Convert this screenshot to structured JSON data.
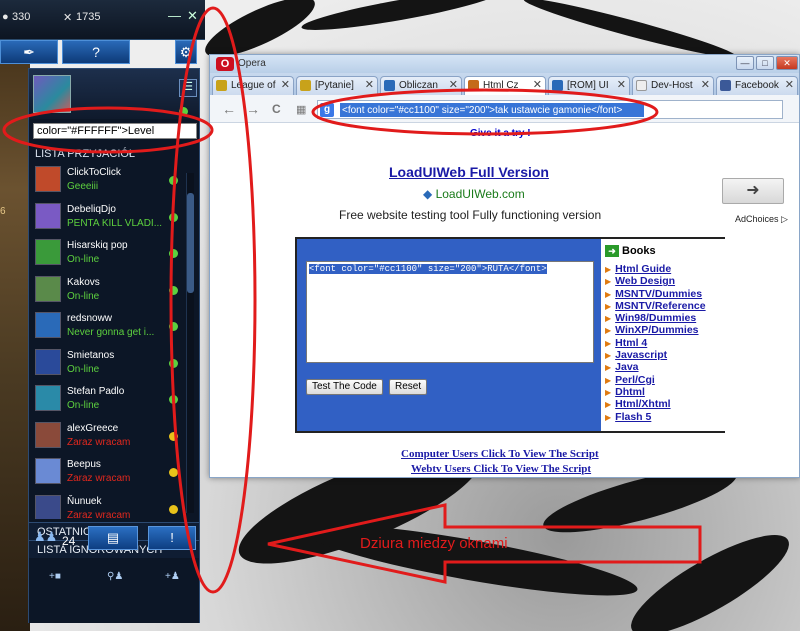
{
  "lol_client": {
    "currency_ip": "330",
    "currency_rp": "1735",
    "help_symbol": "?",
    "side_number": "6",
    "status_input_value": "color=\"#FFFFFF\">Level",
    "friends_header": "LISTA PRZYJACIÓŁ",
    "friends": [
      {
        "name": "ClickToClick",
        "status": "Geeeiii",
        "status_color": "#5dd13f",
        "dot_color": "#5cd13f",
        "avatar_color": "#c04a2a"
      },
      {
        "name": "DebeliqDjo",
        "status": "PENTA KILL VLADI...",
        "status_color": "#5dd13f",
        "dot_color": "#5cd13f",
        "avatar_color": "#7a5ac4"
      },
      {
        "name": "Hisarskiq pop",
        "status": "On-line",
        "status_color": "#5dd13f",
        "dot_color": "#5cd13f",
        "avatar_color": "#3a9a3a"
      },
      {
        "name": "Kakovs",
        "status": "On-line",
        "status_color": "#5dd13f",
        "dot_color": "#5cd13f",
        "avatar_color": "#5a8a4a"
      },
      {
        "name": "redsnoww",
        "status": "Never gonna get i...",
        "status_color": "#5dd13f",
        "dot_color": "#5cd13f",
        "avatar_color": "#2a6ab8"
      },
      {
        "name": "Smietanos",
        "status": "On-line",
        "status_color": "#5dd13f",
        "dot_color": "#5cd13f",
        "avatar_color": "#2a4a9a"
      },
      {
        "name": "Stefan Padlo",
        "status": "On-line",
        "status_color": "#5dd13f",
        "dot_color": "#5cd13f",
        "avatar_color": "#2a8aa8"
      },
      {
        "name": "alexGreece",
        "status": "Zaraz wracam",
        "status_color": "#e0281e",
        "dot_color": "#e8c21a",
        "avatar_color": "#8a4a3a"
      },
      {
        "name": "Beepus",
        "status": "Zaraz wracam",
        "status_color": "#e0281e",
        "dot_color": "#e8c21a",
        "avatar_color": "#6a8ad4"
      },
      {
        "name": "Ňunuek",
        "status": "Zaraz wracam",
        "status_color": "#e0281e",
        "dot_color": "#e8c21a",
        "avatar_color": "#3a4a8a"
      }
    ],
    "recent_label": "OSTATNIO GRANE",
    "ignored_label": "LISTA IGNOROWANYCH",
    "online_count": "24",
    "alert_symbol": "!"
  },
  "browser": {
    "title": "Opera",
    "tabs": [
      {
        "label": "League of",
        "favicon_color": "#c8a21a"
      },
      {
        "label": "[Pytanie]",
        "favicon_color": "#c8a21a"
      },
      {
        "label": "Obliczan",
        "favicon_color": "#2a6ab8"
      },
      {
        "label": "Html Cz",
        "favicon_color": "#c46a1a"
      },
      {
        "label": "[ROM] UI",
        "favicon_color": "#2a6ab8"
      },
      {
        "label": "Dev-Host",
        "favicon_color": "#eeeeee"
      },
      {
        "label": "Facebook",
        "favicon_color": "#3b5998"
      }
    ],
    "url_value": "<font color=\"#cc1100\" size=\"200\">tak ustawcie gamonie</font>",
    "nav_back": "←",
    "nav_forward": "→",
    "nav_reload": "C",
    "give_try": "Give it a try !",
    "ad_title": "LoadUIWeb Full Version",
    "ad_url": "LoadUIWeb.com",
    "ad_desc": "Free website testing tool Fully functioning version",
    "ad_choices": "AdChoices",
    "code_value": "<font color=\"#cc1100\" size=\"200\">RUTA</font>",
    "test_button": "Test The Code",
    "reset_button": "Reset",
    "books_title": "Books",
    "books": [
      "Html Guide",
      "Web Design",
      "MSNTV/Dummies",
      "MSNTV/Reference",
      "Win98/Dummies",
      "WinXP/Dummies",
      "Html 4",
      "Javascript",
      "Java",
      "Perl/Cgi",
      "Dhtml",
      "Html/Xhtml",
      "Flash 5"
    ],
    "link_computer": "Computer Users Click To View The Script",
    "link_webtv": "Webtv Users Click To View The Script"
  },
  "annotation": {
    "caption": "Dziura miedzy oknami",
    "color": "#e11b1b"
  }
}
